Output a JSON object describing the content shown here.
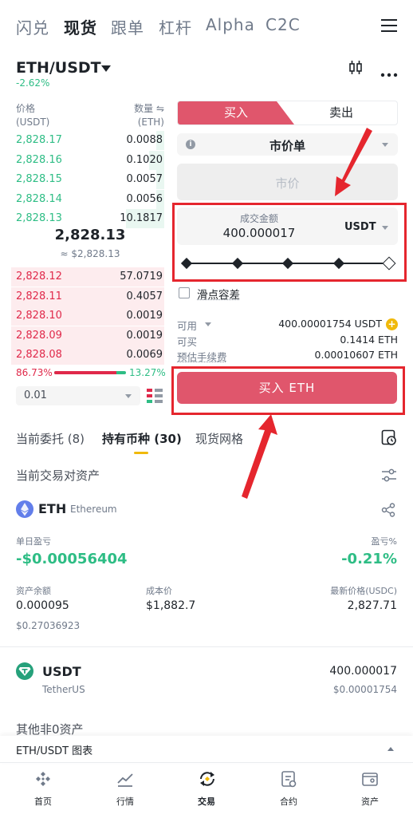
{
  "topnav": {
    "tabs": [
      "闪兑",
      "现货",
      "跟单",
      "杠杆",
      "Alpha",
      "C2C"
    ],
    "active": "现货"
  },
  "pair": {
    "symbol": "ETH/USDT",
    "change": "-2.62%"
  },
  "orderbook": {
    "price_label": "价格",
    "price_unit": "(USDT)",
    "qty_label": "数量 ⇋",
    "qty_unit": "(ETH)",
    "bids": [
      {
        "price": "2,828.17",
        "qty": "0.0088"
      },
      {
        "price": "2,828.16",
        "qty": "0.1020"
      },
      {
        "price": "2,828.15",
        "qty": "0.0057"
      },
      {
        "price": "2,828.14",
        "qty": "0.0056"
      },
      {
        "price": "2,828.13",
        "qty": "10.1817"
      }
    ],
    "bid_fill": [
      0.05,
      0.1,
      0.05,
      0.05,
      0.25
    ],
    "mid_price": "2,828.13",
    "mid_price_usd": "≈ $2,828.13",
    "asks": [
      {
        "price": "2,828.12",
        "qty": "57.0719"
      },
      {
        "price": "2,828.11",
        "qty": "0.4057"
      },
      {
        "price": "2,828.10",
        "qty": "0.0019"
      },
      {
        "price": "2,828.09",
        "qty": "0.0019"
      },
      {
        "price": "2,828.08",
        "qty": "0.0069"
      }
    ],
    "ratio_sell": "86.73%",
    "ratio_buy": "13.27%",
    "ratio_sell_fraction": 0.8673,
    "depth_value": "0.01"
  },
  "order_form": {
    "buy_label": "买入",
    "sell_label": "卖出",
    "order_type": "市价单",
    "price_placeholder": "市价",
    "amount_label": "成交金额",
    "amount_value": "400.000017",
    "amount_unit": "USDT",
    "slippage_label": "滑点容差",
    "available_label": "可用",
    "available_value": "400.00001754 USDT",
    "buyable_label": "可买",
    "buyable_value": "0.1414 ETH",
    "fee_label": "预估手续费",
    "fee_value": "0.00010607 ETH",
    "submit_label": "买入 ETH"
  },
  "tabs": {
    "open_orders": "当前委托 (8)",
    "holdings": "持有币种 (30)",
    "grid": "现货网格"
  },
  "holdings": {
    "section_title": "当前交易对资产",
    "eth": {
      "symbol": "ETH",
      "name": "Ethereum",
      "daily_pnl_label": "单日盈亏",
      "daily_pnl": "-$0.00056404",
      "pnl_pct_label": "盈亏%",
      "pnl_pct": "-0.21%",
      "balance_label": "资产余额",
      "balance": "0.000095",
      "balance_usd": "$0.27036923",
      "cost_label": "成本价",
      "cost": "$1,882.7",
      "last_label": "最新价格(USDC)",
      "last": "2,827.71"
    },
    "usdt": {
      "symbol": "USDT",
      "name": "TetherUS",
      "amount": "400.000017",
      "amount_usd": "$0.00001754"
    },
    "other_title": "其他非0资产"
  },
  "chart_bar": {
    "label": "ETH/USDT 图表"
  },
  "bottom_nav": [
    "首页",
    "行情",
    "交易",
    "合约",
    "资产"
  ],
  "colors": {
    "buy": "#e0566c",
    "green": "#2ebd85",
    "red": "#e0294a",
    "accent": "#f0b90b",
    "highlight": "#e5262e"
  }
}
